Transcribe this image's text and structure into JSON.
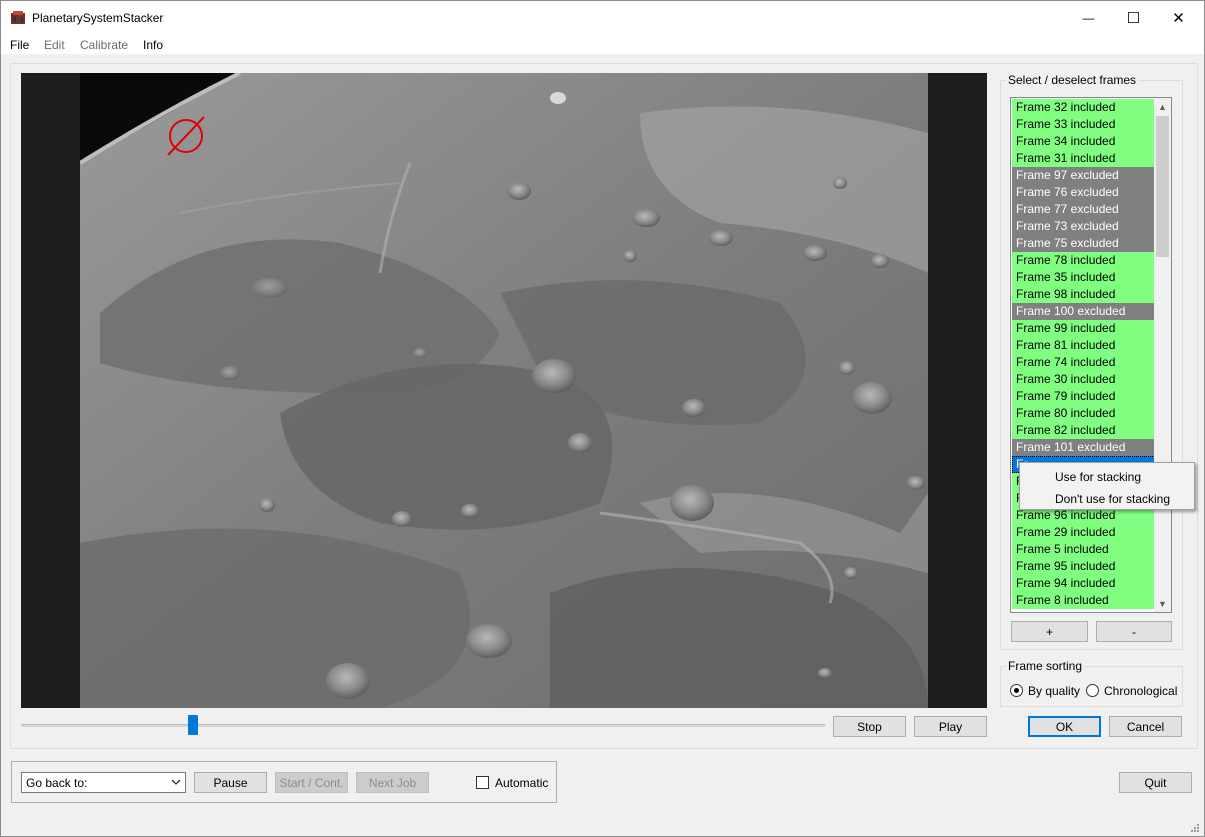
{
  "window": {
    "title": "PlanetarySystemStacker",
    "minimize_glyph": "—",
    "maximize_glyph": "☐",
    "close_glyph": "✕"
  },
  "menu": [
    "File",
    "Edit",
    "Calibrate",
    "Info"
  ],
  "viewer": {
    "playback": {
      "stop_label": "Stop",
      "play_label": "Play"
    }
  },
  "frames_panel": {
    "title": "Select / deselect frames",
    "frames": [
      {
        "label": "Frame 32 included",
        "state": "included"
      },
      {
        "label": "Frame 33 included",
        "state": "included"
      },
      {
        "label": "Frame 34 included",
        "state": "included"
      },
      {
        "label": "Frame 31 included",
        "state": "included"
      },
      {
        "label": "Frame 97 excluded",
        "state": "excluded"
      },
      {
        "label": "Frame 76 excluded",
        "state": "excluded"
      },
      {
        "label": "Frame 77 excluded",
        "state": "excluded"
      },
      {
        "label": "Frame 73 excluded",
        "state": "excluded"
      },
      {
        "label": "Frame 75 excluded",
        "state": "excluded"
      },
      {
        "label": "Frame 78 included",
        "state": "included"
      },
      {
        "label": "Frame 35 included",
        "state": "included"
      },
      {
        "label": "Frame 98 included",
        "state": "included"
      },
      {
        "label": "Frame 100 excluded",
        "state": "excluded"
      },
      {
        "label": "Frame 99 included",
        "state": "included"
      },
      {
        "label": "Frame 81 included",
        "state": "included"
      },
      {
        "label": "Frame 74 included",
        "state": "included"
      },
      {
        "label": "Frame 30 included",
        "state": "included"
      },
      {
        "label": "Frame 79 included",
        "state": "included"
      },
      {
        "label": "Frame 80 included",
        "state": "included"
      },
      {
        "label": "Frame 82 included",
        "state": "included"
      },
      {
        "label": "Frame 101 excluded",
        "state": "excluded"
      },
      {
        "label": "Fr",
        "state": "selected"
      },
      {
        "label": "F",
        "state": "included"
      },
      {
        "label": "F",
        "state": "included"
      },
      {
        "label": "Frame 96 included",
        "state": "included"
      },
      {
        "label": "Frame 29 included",
        "state": "included"
      },
      {
        "label": "Frame 5 included",
        "state": "included"
      },
      {
        "label": "Frame 95 included",
        "state": "included"
      },
      {
        "label": "Frame 94 included",
        "state": "included"
      },
      {
        "label": "Frame 8 included",
        "state": "included"
      }
    ],
    "add_label": "+",
    "remove_label": "-"
  },
  "context_menu": {
    "items": [
      "Use for stacking",
      "Don't use for stacking"
    ]
  },
  "sorting": {
    "title": "Frame sorting",
    "options": [
      "By quality",
      "Chronological"
    ],
    "selected": "By quality"
  },
  "dialog_buttons": {
    "ok_label": "OK",
    "cancel_label": "Cancel"
  },
  "workflow": {
    "go_back_label": "Go back to:",
    "pause_label": "Pause",
    "start_label": "Start / Cont.",
    "next_job_label": "Next Job",
    "automatic_label": "Automatic",
    "automatic_checked": false,
    "quit_label": "Quit"
  },
  "colors": {
    "included_row": "#80ff80",
    "excluded_row": "#808080",
    "selected_row": "#0078d7",
    "slider_handle": "#0078d7",
    "default_button_border": "#0078d7",
    "alignment_marker": "#e00000"
  },
  "icons": [
    "app-icon",
    "no-entry-marker-icon",
    "chevron-down-icon",
    "scroll-up-icon",
    "scroll-down-icon"
  ]
}
